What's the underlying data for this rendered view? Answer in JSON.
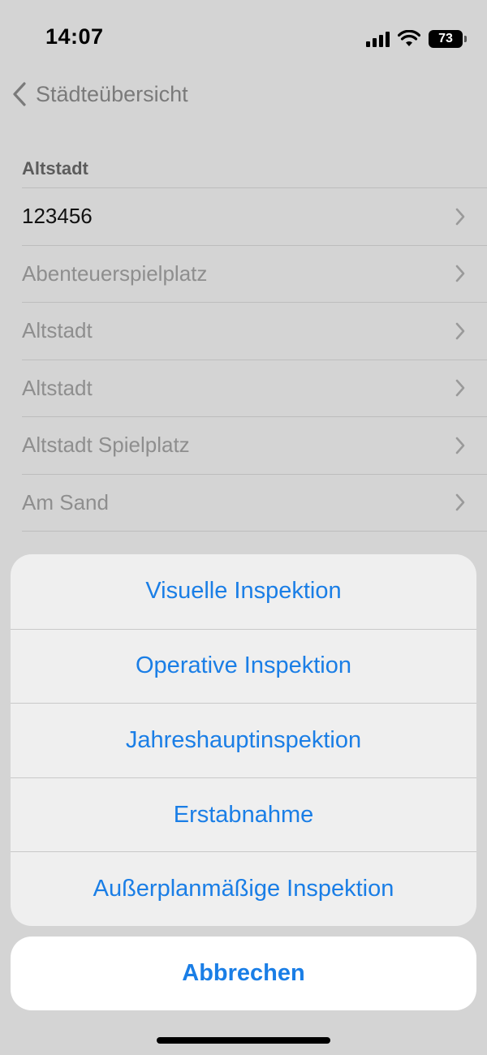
{
  "status_bar": {
    "time": "14:07",
    "battery": "73"
  },
  "nav": {
    "back_label": "Städteübersicht"
  },
  "list": {
    "section_title": "Altstadt",
    "rows": [
      {
        "label": "123456"
      },
      {
        "label": "Abenteuerspielplatz"
      },
      {
        "label": "Altstadt"
      },
      {
        "label": "Altstadt"
      },
      {
        "label": "Altstadt Spielplatz"
      },
      {
        "label": "Am Sand"
      }
    ]
  },
  "action_sheet": {
    "actions": [
      {
        "label": "Visuelle Inspektion"
      },
      {
        "label": "Operative Inspektion"
      },
      {
        "label": "Jahreshauptinspektion"
      },
      {
        "label": "Erstabnahme"
      },
      {
        "label": "Außerplanmäßige Inspektion"
      }
    ],
    "cancel_label": "Abbrechen"
  },
  "colors": {
    "accent": "#1a7ee6",
    "dim_background": "#d4d4d4",
    "sheet_background": "#efefef"
  }
}
